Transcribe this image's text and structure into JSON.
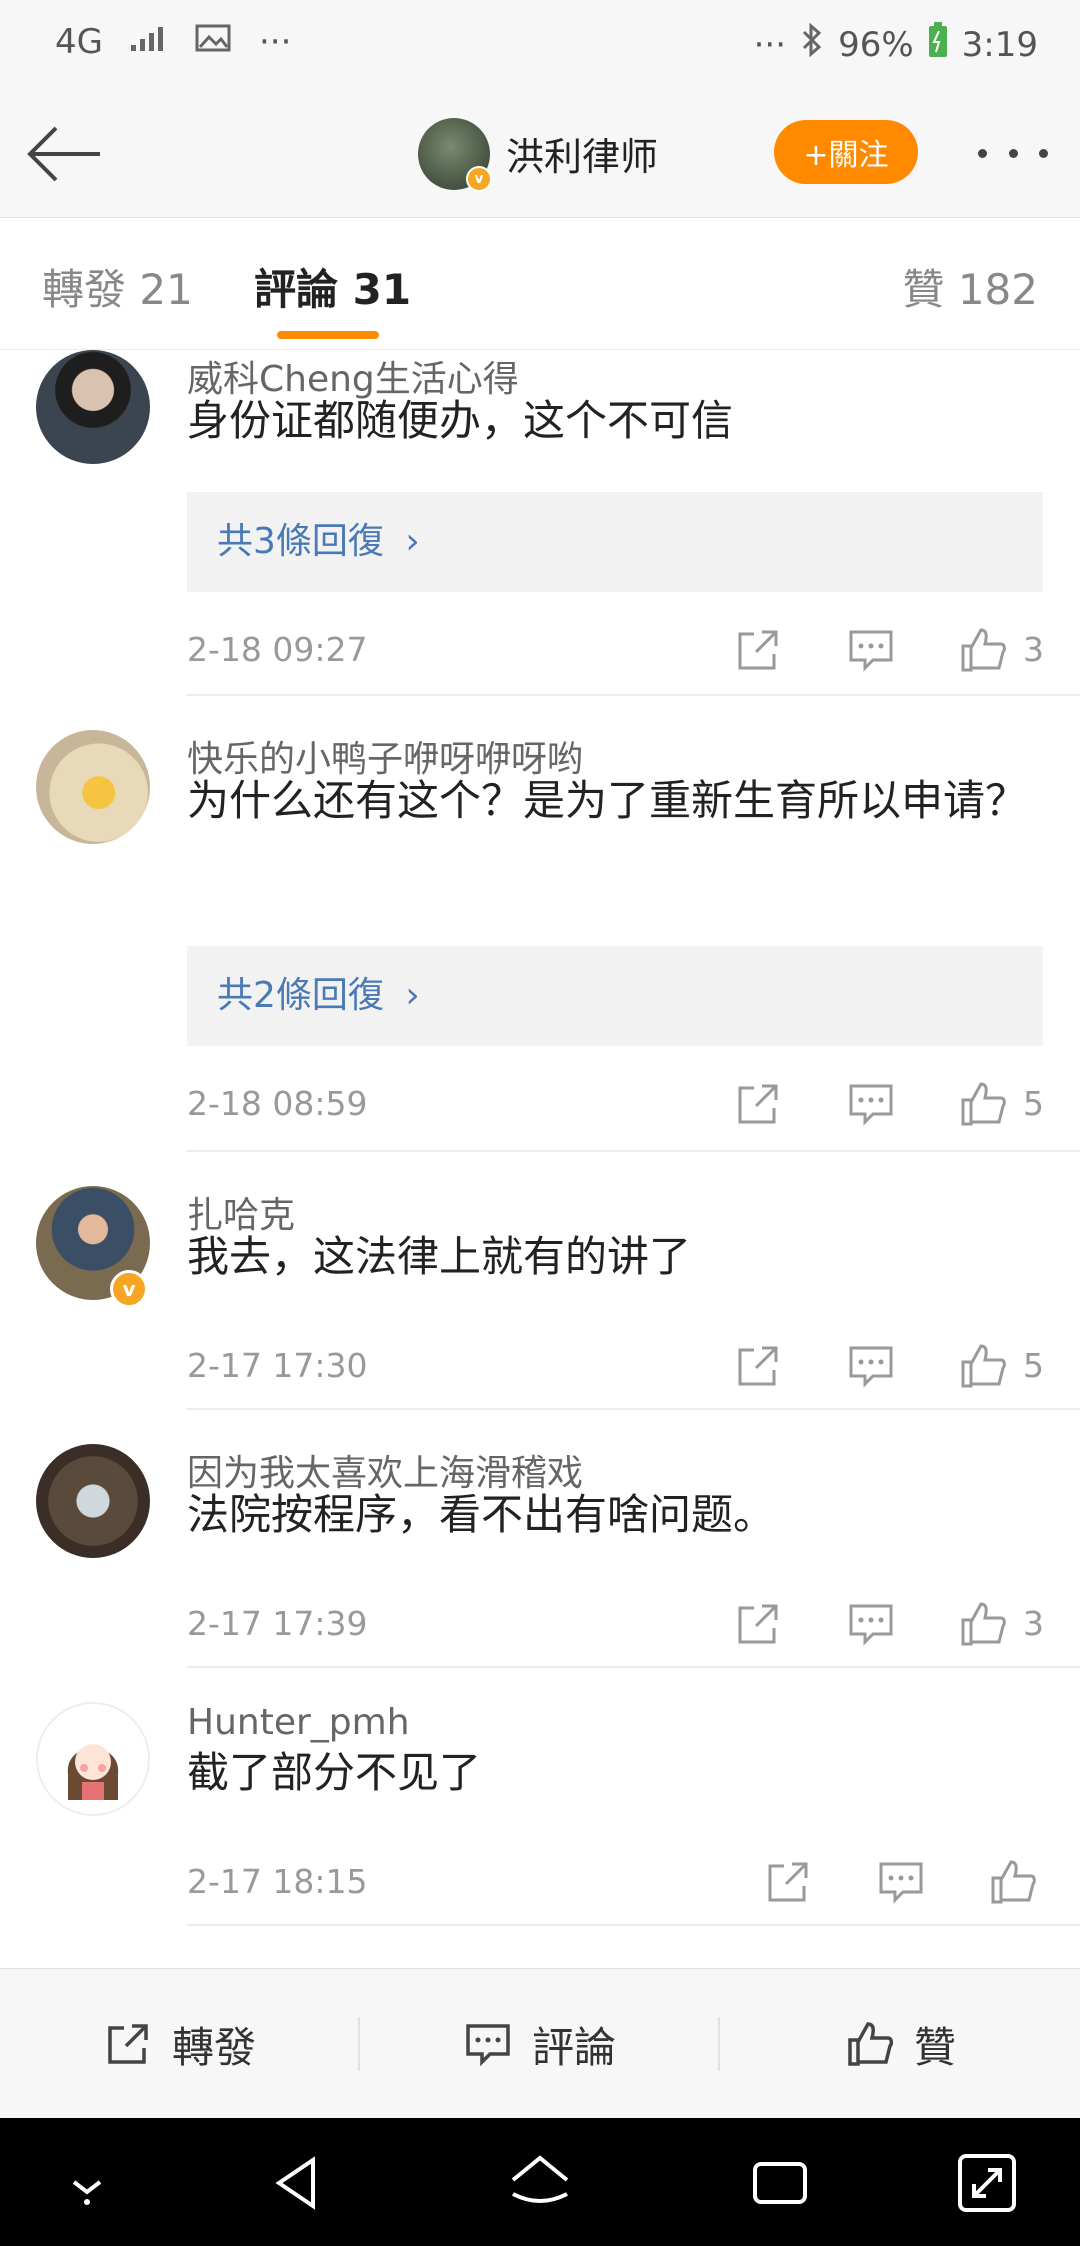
{
  "status_bar": {
    "network": "4G",
    "left_dots": "···",
    "right_dots": "···",
    "battery": "96%",
    "time": "3:19"
  },
  "header": {
    "title": "洪利律师",
    "follow_label": "+關注"
  },
  "tabs": [
    {
      "label": "轉發 21"
    },
    {
      "label": "評論 31"
    },
    {
      "label": "贊 182"
    }
  ],
  "comments": [
    {
      "user": "威科Cheng生活心得",
      "text": "身份证都随便办，这个不可信",
      "replies": "共3條回復",
      "date": "2-18 09:27",
      "likes": "3"
    },
    {
      "user": "快乐的小鸭子咿呀咿呀哟",
      "text": "为什么还有这个？是为了重新生育所以申请？",
      "replies": "共2條回復",
      "date": "2-18 08:59",
      "likes": "5"
    },
    {
      "user": "扎哈克",
      "text": "我去，这法律上就有的讲了",
      "date": "2-17 17:30",
      "likes": "5"
    },
    {
      "user": "因为我太喜欢上海滑稽戏",
      "text": "法院按程序，看不出有啥问题。",
      "date": "2-17 17:39",
      "likes": "3"
    },
    {
      "user": "Hunter_pmh",
      "text": "截了部分不见了",
      "date": "2-17 18:15",
      "likes": ""
    }
  ],
  "bottom_bar": {
    "repost": "轉發",
    "comment": "評論",
    "like": "贊"
  },
  "colors": {
    "accent": "#ff8a00",
    "link": "#4a7ab5",
    "verified": "#f6a623"
  }
}
